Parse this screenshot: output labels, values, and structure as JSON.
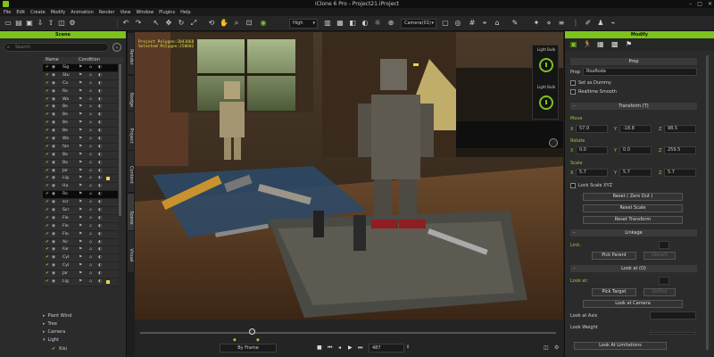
{
  "window": {
    "title": "iClone 6 Pro - Project21.iProject"
  },
  "menu": [
    "File",
    "Edit",
    "Create",
    "Modify",
    "Animation",
    "Render",
    "View",
    "Window",
    "Plugins",
    "Help"
  ],
  "toolbar": {
    "quality": "High",
    "camera": "Camera(01)"
  },
  "scene": {
    "header": "Scene",
    "search_placeholder": "Search",
    "col_name": "Name",
    "col_condition": "Condition",
    "items": [
      {
        "name": "Sig",
        "selected": true,
        "tag": false
      },
      {
        "name": "Stu",
        "selected": false,
        "tag": false
      },
      {
        "name": "Ca",
        "selected": false,
        "tag": false
      },
      {
        "name": "Ro",
        "selected": false,
        "tag": false
      },
      {
        "name": "Wa",
        "selected": false,
        "tag": false
      },
      {
        "name": "Bo",
        "selected": false,
        "tag": false
      },
      {
        "name": "Bo",
        "selected": false,
        "tag": false
      },
      {
        "name": "Bo",
        "selected": false,
        "tag": false
      },
      {
        "name": "Bo",
        "selected": false,
        "tag": false
      },
      {
        "name": "Wa",
        "selected": false,
        "tag": false
      },
      {
        "name": "fan",
        "selected": false,
        "tag": false
      },
      {
        "name": "Bo",
        "selected": false,
        "tag": false
      },
      {
        "name": "Bo",
        "selected": false,
        "tag": false
      },
      {
        "name": "Jar",
        "selected": false,
        "tag": false
      },
      {
        "name": "Lig",
        "selected": false,
        "tag": true
      },
      {
        "name": "Ha",
        "selected": false,
        "tag": false
      },
      {
        "name": "Ro",
        "selected": true,
        "tag": false
      },
      {
        "name": "scr",
        "selected": false,
        "tag": false
      },
      {
        "name": "Scr",
        "selected": false,
        "tag": false
      },
      {
        "name": "Flo",
        "selected": false,
        "tag": false
      },
      {
        "name": "Flo",
        "selected": false,
        "tag": false
      },
      {
        "name": "Flo",
        "selected": false,
        "tag": false
      },
      {
        "name": "Air",
        "selected": false,
        "tag": false
      },
      {
        "name": "Far",
        "selected": false,
        "tag": false
      },
      {
        "name": "Cyl",
        "selected": false,
        "tag": false
      },
      {
        "name": "Cyl",
        "selected": false,
        "tag": false
      },
      {
        "name": "Jar",
        "selected": false,
        "tag": false
      },
      {
        "name": "Lig",
        "selected": false,
        "tag": true
      }
    ],
    "groups": [
      "Plant Wind",
      "Tree",
      "Camera",
      "Light"
    ],
    "last_item": "Kisi"
  },
  "side_tabs": [
    "Render",
    "Nodge",
    "Project",
    "Content",
    "Scene",
    "Visual"
  ],
  "viewport": {
    "stats_line1": "Project Polygon:2043868",
    "stats_line2": "Selected Polygon:250682"
  },
  "timeline": {
    "frame_mode": "By Frame",
    "frame_number": "487"
  },
  "lights": {
    "title1": "Light Bulb",
    "title2": "Light Bulb"
  },
  "modify": {
    "header": "Modify",
    "prop_section": "Prop",
    "prop_label": "Prop",
    "prop_name": "RoaRoda",
    "set_dummy": "Set as Dummy",
    "realtime_smooth": "Realtime Smooth",
    "transform_section": "Transform (T)",
    "move_label": "Move",
    "move": {
      "x": "57.0",
      "y": "-18.8",
      "z": "98.5"
    },
    "rotate_label": "Rotate",
    "rotate": {
      "x": "0.0",
      "y": "0.0",
      "z": "259.5"
    },
    "scale_label": "Scale",
    "scale": {
      "x": "5.7",
      "y": "5.7",
      "z": "5.7"
    },
    "lock_scale": "Lock Scale XYZ",
    "reset_zero": "Reset ( Zero Out )",
    "reset_scale": "Reset Scale",
    "reset_transform": "Reset Transform",
    "linkage_section": "Linkage",
    "link_label": "Link:",
    "pick_parent": "Pick Parent",
    "detach": "Detach",
    "lookat_section": "Look at (O)",
    "lookat_label": "Look at:",
    "pick_target": "Pick Target",
    "unpick": "UnPick",
    "look_at_camera": "Look at Camera",
    "look_at_axis": "Look at Axis",
    "look_weight": "Look Weight",
    "look_limitations": "Look At Limitations"
  }
}
